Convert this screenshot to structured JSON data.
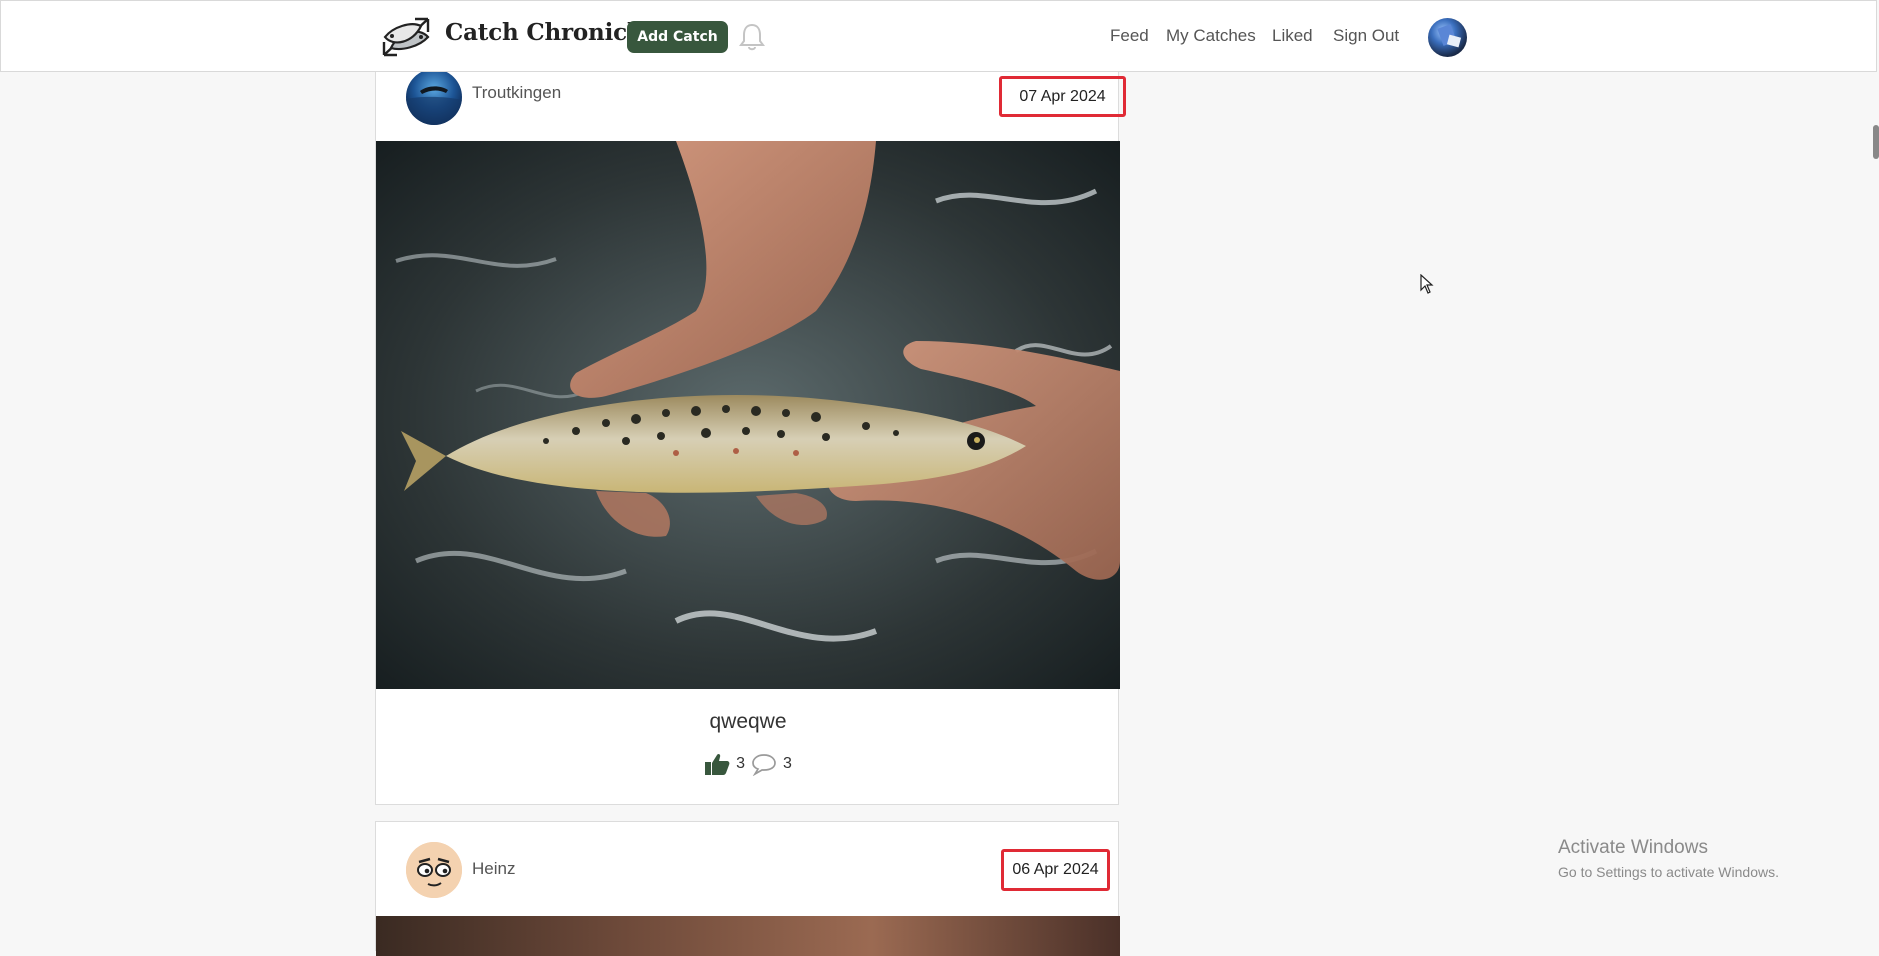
{
  "header": {
    "brand_name": "Catch Chronicle",
    "add_catch_label": "Add Catch",
    "nav": [
      "Feed",
      "My Catches",
      "Liked",
      "Sign Out"
    ],
    "accent_color": "#38573d"
  },
  "posts": [
    {
      "username": "Troutkingen",
      "date": "07 Apr 2024",
      "caption": "qweqwe",
      "likes": "3",
      "comments": "3",
      "like_icon": "thumbs-up-icon",
      "comment_icon": "comment-bubble-icon"
    },
    {
      "username": "Heinz",
      "date": "06 Apr 2024"
    }
  ],
  "windows_notice": {
    "title": "Activate Windows",
    "subtitle": "Go to Settings to activate Windows."
  },
  "colors": {
    "date_highlight": "#e02a35",
    "page_bg": "#f7f7f7"
  }
}
